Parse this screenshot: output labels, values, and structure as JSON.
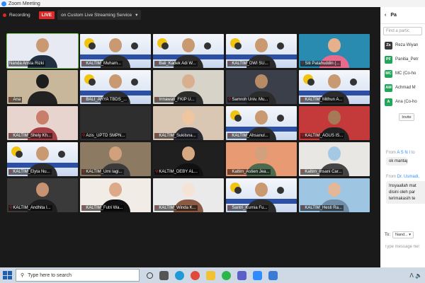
{
  "window": {
    "title": "Zoom Meeting"
  },
  "topbar": {
    "recording_label": "Recording",
    "live_label": "LIVE",
    "stream_label": "on Custom Live Streaming Service",
    "dropdown_glyph": "▾"
  },
  "tiles": [
    {
      "name": "Nanda Arista Rizki",
      "kind": "person",
      "bg": "#e7eaf3",
      "face": "#c99a72",
      "body": "#203040",
      "mic": false
    },
    {
      "name": "KALTIM_Muham...",
      "kind": "poster",
      "mic": true
    },
    {
      "name": "Bali_Kadek Adi W...",
      "kind": "poster",
      "mic": true
    },
    {
      "name": "KALTIM_DWI SU...",
      "kind": "poster",
      "mic": true
    },
    {
      "name": "Siti Patahuddin (...",
      "kind": "person",
      "bg": "#2a8bb0",
      "face": "#e7b08c",
      "body": "#e86a8c",
      "mic": true
    },
    {
      "name": "Ana",
      "kind": "person",
      "bg": "#c9b79c",
      "face": "#1d1d1d",
      "body": "#222",
      "mic": true
    },
    {
      "name": "BALI_ARYA TBDS_...",
      "kind": "poster",
      "mic": true
    },
    {
      "name": "Irmawati_FKIP U...",
      "kind": "person",
      "bg": "#d8d3c9",
      "face": "#d9b08f",
      "body": "#2d2d2d",
      "mic": true
    },
    {
      "name": "Samroh Univ. Mu...",
      "kind": "person",
      "bg": "#3b3f4a",
      "face": "#b78b66",
      "body": "#2b2b2b",
      "mic": true
    },
    {
      "name": "KALTIM_Mithun A...",
      "kind": "poster",
      "mic": true
    },
    {
      "name": "KALTIM_Shely Kh...",
      "kind": "person",
      "bg": "#e8d4cf",
      "face": "#c97e6a",
      "body": "#a33f47",
      "mic": true
    },
    {
      "name": "Azis_UPTD SMPN...",
      "kind": "blank",
      "bg": "#2e2e2e",
      "mic": true
    },
    {
      "name": "KALTIM_Sukilsna...",
      "kind": "person",
      "bg": "#d9c6b3",
      "face": "#f0c6a0",
      "body": "#2b2b35",
      "mic": true
    },
    {
      "name": "KALTIM_Ahsanul...",
      "kind": "poster",
      "mic": true
    },
    {
      "name": "KALTIM_AGUS IS...",
      "kind": "person",
      "bg": "#c43a3a",
      "face": "#a67a57",
      "body": "#222",
      "mic": true
    },
    {
      "name": "KALTIM_Elyta Nu...",
      "kind": "poster",
      "mic": true
    },
    {
      "name": "KALTIM_Umi lagi...",
      "kind": "person",
      "bg": "#8c7a63",
      "face": "#d1a17e",
      "body": "#3a3a3a",
      "mic": true
    },
    {
      "name": "KALTIM_DEBY AL...",
      "kind": "person",
      "bg": "#1f1f1f",
      "face": "#d7a983",
      "body": "#111",
      "mic": true
    },
    {
      "name": "Kaltim_Astien Jea...",
      "kind": "person",
      "bg": "#e89a72",
      "face": "#d0a07f",
      "body": "#4a6b4e",
      "mic": true
    },
    {
      "name": "Kaltim_Insani Car...",
      "kind": "person",
      "bg": "#e9e7e4",
      "face": "#a3c9e4",
      "body": "#444",
      "mic": true
    },
    {
      "name": "KALTIM_Andhita I...",
      "kind": "person",
      "bg": "#3a3a3a",
      "face": "#c99272",
      "body": "#1e1e1e",
      "mic": true
    },
    {
      "name": "KALTIM_Futri Wa...",
      "kind": "person",
      "bg": "#f2ece6",
      "face": "#dcaa88",
      "body": "#111",
      "mic": true
    },
    {
      "name": "KALTIM_Winda K...",
      "kind": "person",
      "bg": "#eaeaea",
      "face": "#f5e3d6",
      "body": "#8a5a44",
      "mic": true
    },
    {
      "name": "Santri_Kurnia Fu...",
      "kind": "poster",
      "mic": true
    },
    {
      "name": "KALTIM_Hesti Ra...",
      "kind": "person",
      "bg": "#9ec6e2",
      "face": "#e2b898",
      "body": "#6f8ea6",
      "mic": true
    }
  ],
  "active_tile_index": 0,
  "sidepanel": {
    "title": "Pa",
    "search_placeholder": "Find a partic",
    "participants": [
      {
        "initials": "Zs",
        "name": "Reza Wiyan",
        "color": "#3a3a3a"
      },
      {
        "initials": "PF",
        "name": "Panitia_Petr",
        "color": "#23a55a"
      },
      {
        "initials": "MC",
        "name": "MC (Co-ho",
        "color": "#23a55a"
      },
      {
        "initials": "AM",
        "name": "Achmad M",
        "color": "#23a55a"
      },
      {
        "initials": "A",
        "name": "Ana (Co-ho",
        "color": "#23a55a"
      }
    ],
    "invite_label": "Invite"
  },
  "chat": {
    "msg1_from_prefix": "From",
    "msg1_from_name": "A S N I",
    "msg1_from_suffix": " to",
    "msg1_text": "ok mantap",
    "msg2_from_prefix": "From",
    "msg2_from_name": "Dr. Usmadi,",
    "msg2_text": "Insyaallah mat disini oleh par terimakasih te",
    "to_label": "To:",
    "to_value": "Nand... ▾",
    "input_placeholder": "Type message her"
  },
  "taskbar": {
    "search_placeholder": "Type here to search",
    "search_icon": "⚲",
    "right_text": "ᐱ 🔈"
  }
}
